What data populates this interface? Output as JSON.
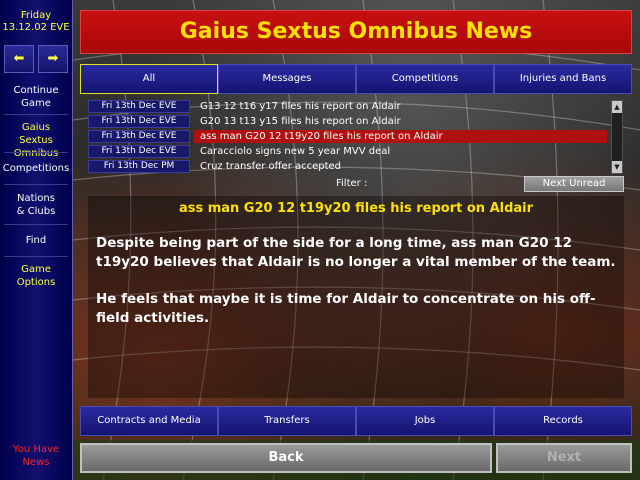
{
  "sidebar": {
    "day": "Friday",
    "date": "13.12.02 EVE",
    "back_arrow": "left-arrow-icon",
    "forward_arrow": "right-arrow-icon",
    "items": [
      {
        "label": "Continue Game"
      },
      {
        "label": "Gaius Sextus Omnibus"
      },
      {
        "label": "Competitions"
      },
      {
        "label": "Nations & Clubs"
      },
      {
        "label": "Find"
      },
      {
        "label": "Game Options"
      }
    ],
    "news_notice": "You Have News"
  },
  "header": {
    "title": "Gaius Sextus Omnibus News"
  },
  "tabs": [
    {
      "label": "All"
    },
    {
      "label": "Messages"
    },
    {
      "label": "Competitions"
    },
    {
      "label": "Injuries and Bans"
    }
  ],
  "messages": [
    {
      "date": "Fri 13th Dec EVE",
      "title": "G13 12 t16 y17 files his report on Aldair"
    },
    {
      "date": "Fri 13th Dec EVE",
      "title": "G20 13 t13 y15 files his report on Aldair"
    },
    {
      "date": "Fri 13th Dec EVE",
      "title": "ass man G20 12 t19y20 files his report on Aldair"
    },
    {
      "date": "Fri 13th Dec EVE",
      "title": "Caracciolo signs new 5 year MVV deal"
    },
    {
      "date": "Fri 13th Dec PM",
      "title": "Cruz transfer offer accepted"
    }
  ],
  "filter": {
    "label": "Filter :",
    "next_unread": "Next Unread"
  },
  "message_view": {
    "subject": "ass man G20 12 t19y20 files his report on Aldair",
    "para1": "Despite being part of the side for a long time, ass man G20 12 t19y20 believes that Aldair is no longer a vital member of the team.",
    "para2": "He feels that maybe it is time for Aldair to concentrate on his off-field activities."
  },
  "bottom": {
    "buttons": [
      {
        "label": "Contracts and Media"
      },
      {
        "label": "Transfers"
      },
      {
        "label": "Jobs"
      },
      {
        "label": "Records"
      }
    ],
    "back": "Back",
    "next": "Next"
  },
  "colors": {
    "accent_yellow": "#ffe000",
    "title_red": "#c81010",
    "button_blue": "#141470"
  }
}
